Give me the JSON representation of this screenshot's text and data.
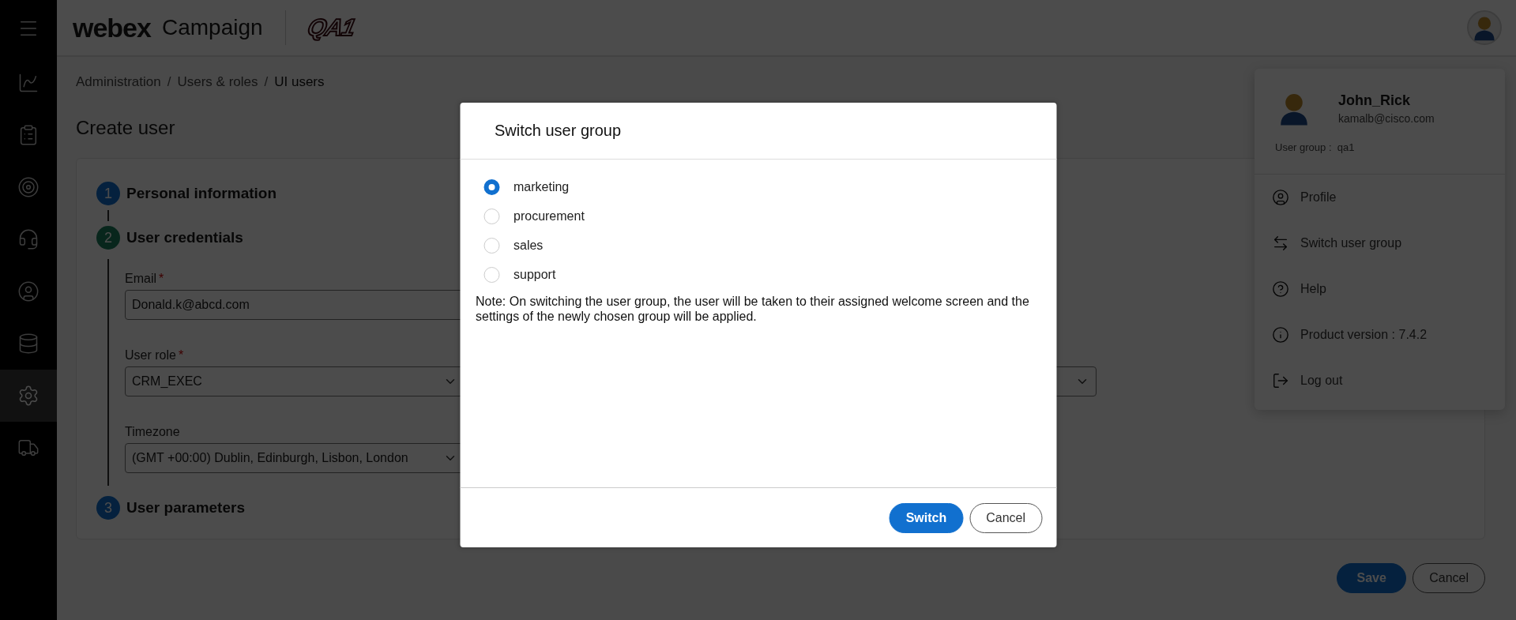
{
  "header": {
    "brand": "webex",
    "product": "Campaign",
    "logo_badge": "QA1"
  },
  "sidebar": {
    "items": [
      {
        "selected": false
      },
      {
        "selected": false
      },
      {
        "selected": false
      },
      {
        "selected": false
      },
      {
        "selected": false
      },
      {
        "selected": false
      },
      {
        "selected": true
      },
      {
        "selected": false
      }
    ]
  },
  "breadcrumb": [
    {
      "label": "Administration",
      "current": false
    },
    {
      "label": "Users & roles",
      "current": false
    },
    {
      "label": "UI users",
      "current": true
    }
  ],
  "breadcrumb_separator": "/",
  "page_title": "Create user",
  "steps": [
    {
      "number": "1",
      "title": "Personal information",
      "active": false
    },
    {
      "number": "2",
      "title": "User credentials",
      "active": true
    },
    {
      "number": "3",
      "title": "User parameters",
      "active": false
    }
  ],
  "fields": [
    {
      "kind": "input",
      "label": "Email",
      "required_mark": "*",
      "value": "Donald.k@abcd.com"
    },
    {
      "kind": "select",
      "label": "User role",
      "required_mark": "*",
      "value": "CRM_EXEC"
    },
    {
      "kind": "select",
      "label": "Timezone",
      "value": "(GMT +00:00) Dublin, Edinburgh, Lisbon, London"
    }
  ],
  "footer_buttons": [
    {
      "kind": "primary",
      "label": "Save"
    },
    {
      "kind": "secondary",
      "label": "Cancel"
    }
  ],
  "user_menu": {
    "name": "John_Rick",
    "email": "kamalb@cisco.com",
    "group_label": "User group :",
    "group_value": "qa1",
    "items": [
      {
        "label": "Profile"
      },
      {
        "label": "Switch user group"
      },
      {
        "label": "Help"
      },
      {
        "label": "Product version : 7.4.2"
      },
      {
        "label": "Log out"
      }
    ]
  },
  "dialog": {
    "title": "Switch user group",
    "options": [
      {
        "label": "marketing",
        "selected": true
      },
      {
        "label": "procurement",
        "selected": false
      },
      {
        "label": "sales",
        "selected": false
      },
      {
        "label": "support",
        "selected": false
      }
    ],
    "note": "Note: On switching the user group, the user will be taken to their assigned welcome screen and the settings of the newly chosen group will be applied.",
    "buttons": [
      {
        "kind": "primary",
        "label": "Switch"
      },
      {
        "kind": "secondary",
        "label": "Cancel"
      }
    ]
  }
}
